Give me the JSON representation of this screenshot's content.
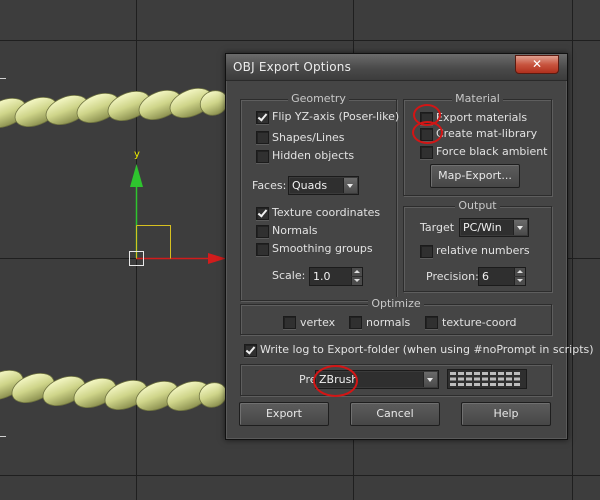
{
  "viewport": {
    "axis_label": "y",
    "colors": {
      "background": "#3d3d3d",
      "rope": "#d4d991",
      "axis_y": "#2ec42e",
      "axis_x": "#d11c1c",
      "grid": "#1e1e1e"
    }
  },
  "dialog": {
    "title": "OBJ Export Options",
    "close_icon": "close-icon",
    "geometry": {
      "title": "Geometry",
      "flip_yz": {
        "label": "Flip YZ-axis (Poser-like)",
        "checked": true
      },
      "shapes_lines": {
        "label": "Shapes/Lines",
        "checked": false
      },
      "hidden_objects": {
        "label": "Hidden objects",
        "checked": false
      },
      "faces_label": "Faces:",
      "faces_value": "Quads",
      "texture_coordinates": {
        "label": "Texture coordinates",
        "checked": true
      },
      "normals": {
        "label": "Normals",
        "checked": false
      },
      "smoothing_groups": {
        "label": "Smoothing groups",
        "checked": false
      },
      "scale_label": "Scale:",
      "scale_value": "1.0"
    },
    "material": {
      "title": "Material",
      "export_materials": {
        "label": "Export materials",
        "checked": false
      },
      "create_mat_library": {
        "label": "Create mat-library",
        "checked": false
      },
      "force_black_ambient": {
        "label": "Force black ambient",
        "checked": false
      },
      "map_export_button": "Map-Export..."
    },
    "output": {
      "title": "Output",
      "target_label": "Target",
      "target_value": "PC/Win",
      "relative_numbers": {
        "label": "relative numbers",
        "checked": false
      },
      "precision_label": "Precision:",
      "precision_value": "6"
    },
    "optimize": {
      "title": "Optimize",
      "vertex": {
        "label": "vertex",
        "checked": false
      },
      "normals": {
        "label": "normals",
        "checked": false
      },
      "texture_coord": {
        "label": "texture-coord",
        "checked": false
      }
    },
    "write_log": {
      "label": "Write log to Export-folder (when using #noPrompt in scripts)",
      "checked": true
    },
    "preset": {
      "label": "Preset:",
      "value": "ZBrush"
    },
    "buttons": {
      "export": "Export",
      "cancel": "Cancel",
      "help": "Help"
    },
    "annotation_color": "#d31515"
  }
}
